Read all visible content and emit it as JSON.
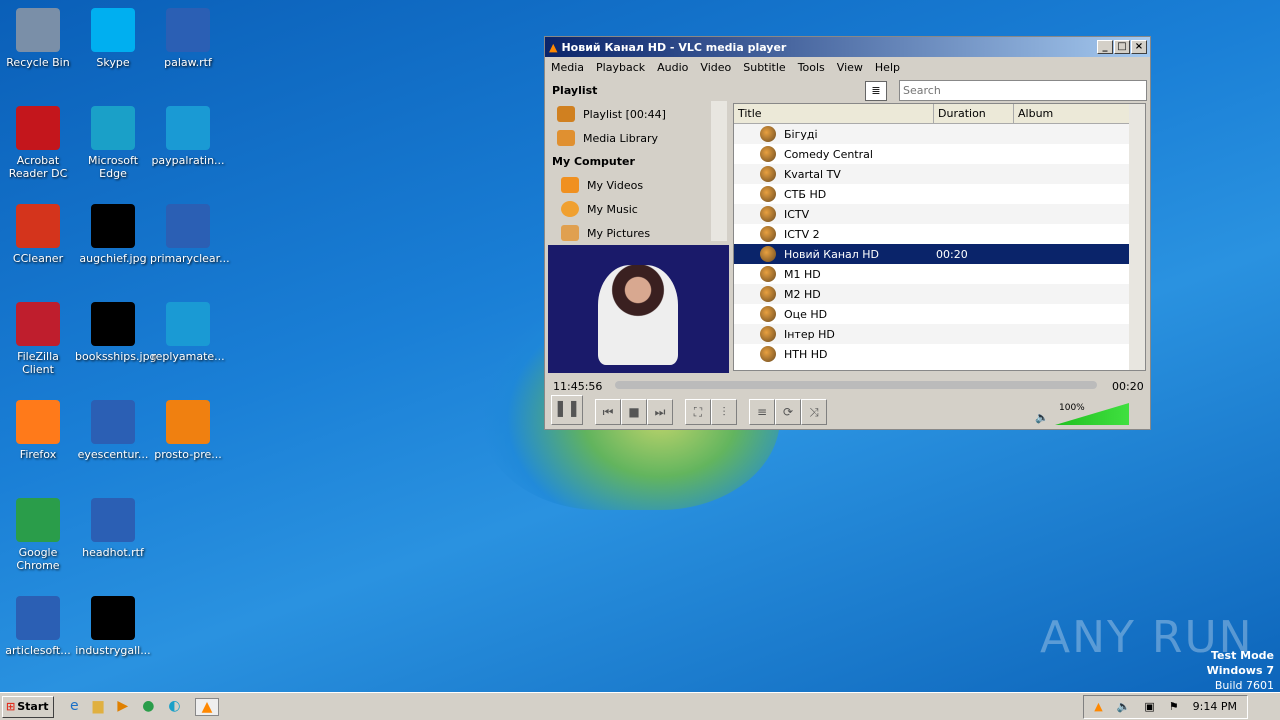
{
  "desktop": {
    "icons": [
      {
        "label": "Recycle Bin",
        "color": "#7a8fa8"
      },
      {
        "label": "Acrobat Reader DC",
        "color": "#c4161c"
      },
      {
        "label": "CCleaner",
        "color": "#d4341c"
      },
      {
        "label": "FileZilla Client",
        "color": "#bf1e2d"
      },
      {
        "label": "Firefox",
        "color": "#ff7a1a"
      },
      {
        "label": "Google Chrome",
        "color": "#2a9d4a"
      },
      {
        "label": "articlesoft...",
        "color": "#2b5fb4"
      },
      {
        "label": "Skype",
        "color": "#00aff0"
      },
      {
        "label": "Microsoft Edge",
        "color": "#1aa0c8"
      },
      {
        "label": "augchief.jpg",
        "color": "#000000"
      },
      {
        "label": "booksships.jpg",
        "color": "#000000"
      },
      {
        "label": "eyescentur...",
        "color": "#2b5fb4"
      },
      {
        "label": "headhot.rtf",
        "color": "#2b5fb4"
      },
      {
        "label": "industrygall...",
        "color": "#000000"
      },
      {
        "label": "palaw.rtf",
        "color": "#2b5fb4"
      },
      {
        "label": "paypalratin...",
        "color": "#1a9ad4"
      },
      {
        "label": "primaryclear...",
        "color": "#2b5fb4"
      },
      {
        "label": "replyamate...",
        "color": "#1a9ad4"
      },
      {
        "label": "prosto-pre...",
        "color": "#f08010"
      }
    ]
  },
  "vlc": {
    "title": "Новий Канал HD - VLC media player",
    "menu": [
      "Media",
      "Playback",
      "Audio",
      "Video",
      "Subtitle",
      "Tools",
      "View",
      "Help"
    ],
    "search_placeholder": "Search",
    "sidebar": {
      "playlist_heading": "Playlist",
      "playlist_item": "Playlist [00:44]",
      "media_library": "Media Library",
      "my_computer": "My Computer",
      "videos": "My Videos",
      "music": "My Music",
      "pictures": "My Pictures"
    },
    "columns": [
      "Title",
      "Duration",
      "Album"
    ],
    "rows": [
      {
        "title": "Бігуді",
        "duration": ""
      },
      {
        "title": "Comedy Central",
        "duration": ""
      },
      {
        "title": "Kvartal TV",
        "duration": ""
      },
      {
        "title": "СТБ HD",
        "duration": ""
      },
      {
        "title": "ICTV",
        "duration": ""
      },
      {
        "title": "ICTV 2",
        "duration": ""
      },
      {
        "title": "Новий Канал HD",
        "duration": "00:20",
        "selected": true
      },
      {
        "title": "M1 HD",
        "duration": ""
      },
      {
        "title": "M2 HD",
        "duration": ""
      },
      {
        "title": "Оце HD",
        "duration": ""
      },
      {
        "title": "Інтер HD",
        "duration": ""
      },
      {
        "title": "НТН HD",
        "duration": ""
      }
    ],
    "time_elapsed": "11:45:56",
    "time_total": "00:20",
    "volume": "100%",
    "volume_level": 100,
    "accent": "#0a246a"
  },
  "watermark": {
    "brand": "ANY RUN",
    "line1": "Test Mode",
    "line2": "Windows 7",
    "line3": "Build 7601"
  },
  "taskbar": {
    "start": "Start",
    "clock": "9:14 PM"
  }
}
